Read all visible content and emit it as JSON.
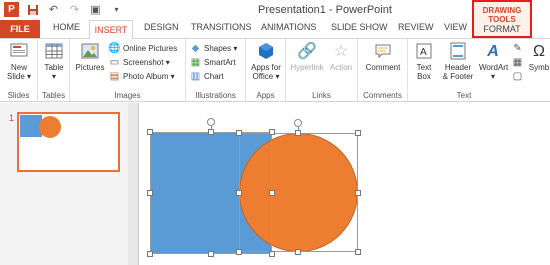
{
  "window": {
    "title": "Presentation1 - PowerPoint"
  },
  "contextual": {
    "group_label": "DRAWING TOOLS",
    "tab_label": "FORMAT"
  },
  "tabs": {
    "file": "FILE",
    "home": "HOME",
    "insert": "INSERT",
    "design": "DESIGN",
    "transitions": "TRANSITIONS",
    "animations": "ANIMATIONS",
    "slideshow": "SLIDE SHOW",
    "review": "REVIEW",
    "view": "VIEW"
  },
  "ribbon": {
    "slides": {
      "label": "Slides",
      "new_slide_1": "New",
      "new_slide_2": "Slide ▾"
    },
    "tables": {
      "label": "Tables",
      "table": "Table",
      "table_arrow": "▾"
    },
    "images": {
      "label": "Images",
      "pictures": "Pictures",
      "online_pictures": "Online Pictures",
      "screenshot": "Screenshot ▾",
      "photo_album": "Photo Album ▾"
    },
    "illustrations": {
      "label": "Illustrations",
      "shapes": "Shapes ▾",
      "smartart": "SmartArt",
      "chart": "Chart"
    },
    "apps": {
      "label": "Apps",
      "apps_1": "Apps for",
      "apps_2": "Office ▾"
    },
    "links": {
      "label": "Links",
      "hyperlink": "Hyperlink",
      "action": "Action"
    },
    "comments": {
      "label": "Comments",
      "comment": "Comment"
    },
    "text": {
      "label": "Text",
      "text_box_1": "Text",
      "text_box_2": "Box",
      "header_footer_1": "Header",
      "header_footer_2": "& Footer",
      "wordart": "WordArt ▾",
      "symbols": "Symb"
    }
  },
  "thumbnails": [
    {
      "number": "1"
    }
  ],
  "colors": {
    "accent": "#d24726",
    "rect": "#5b9bd5",
    "circle": "#ed7d31",
    "ctx_border": "#e02020"
  }
}
